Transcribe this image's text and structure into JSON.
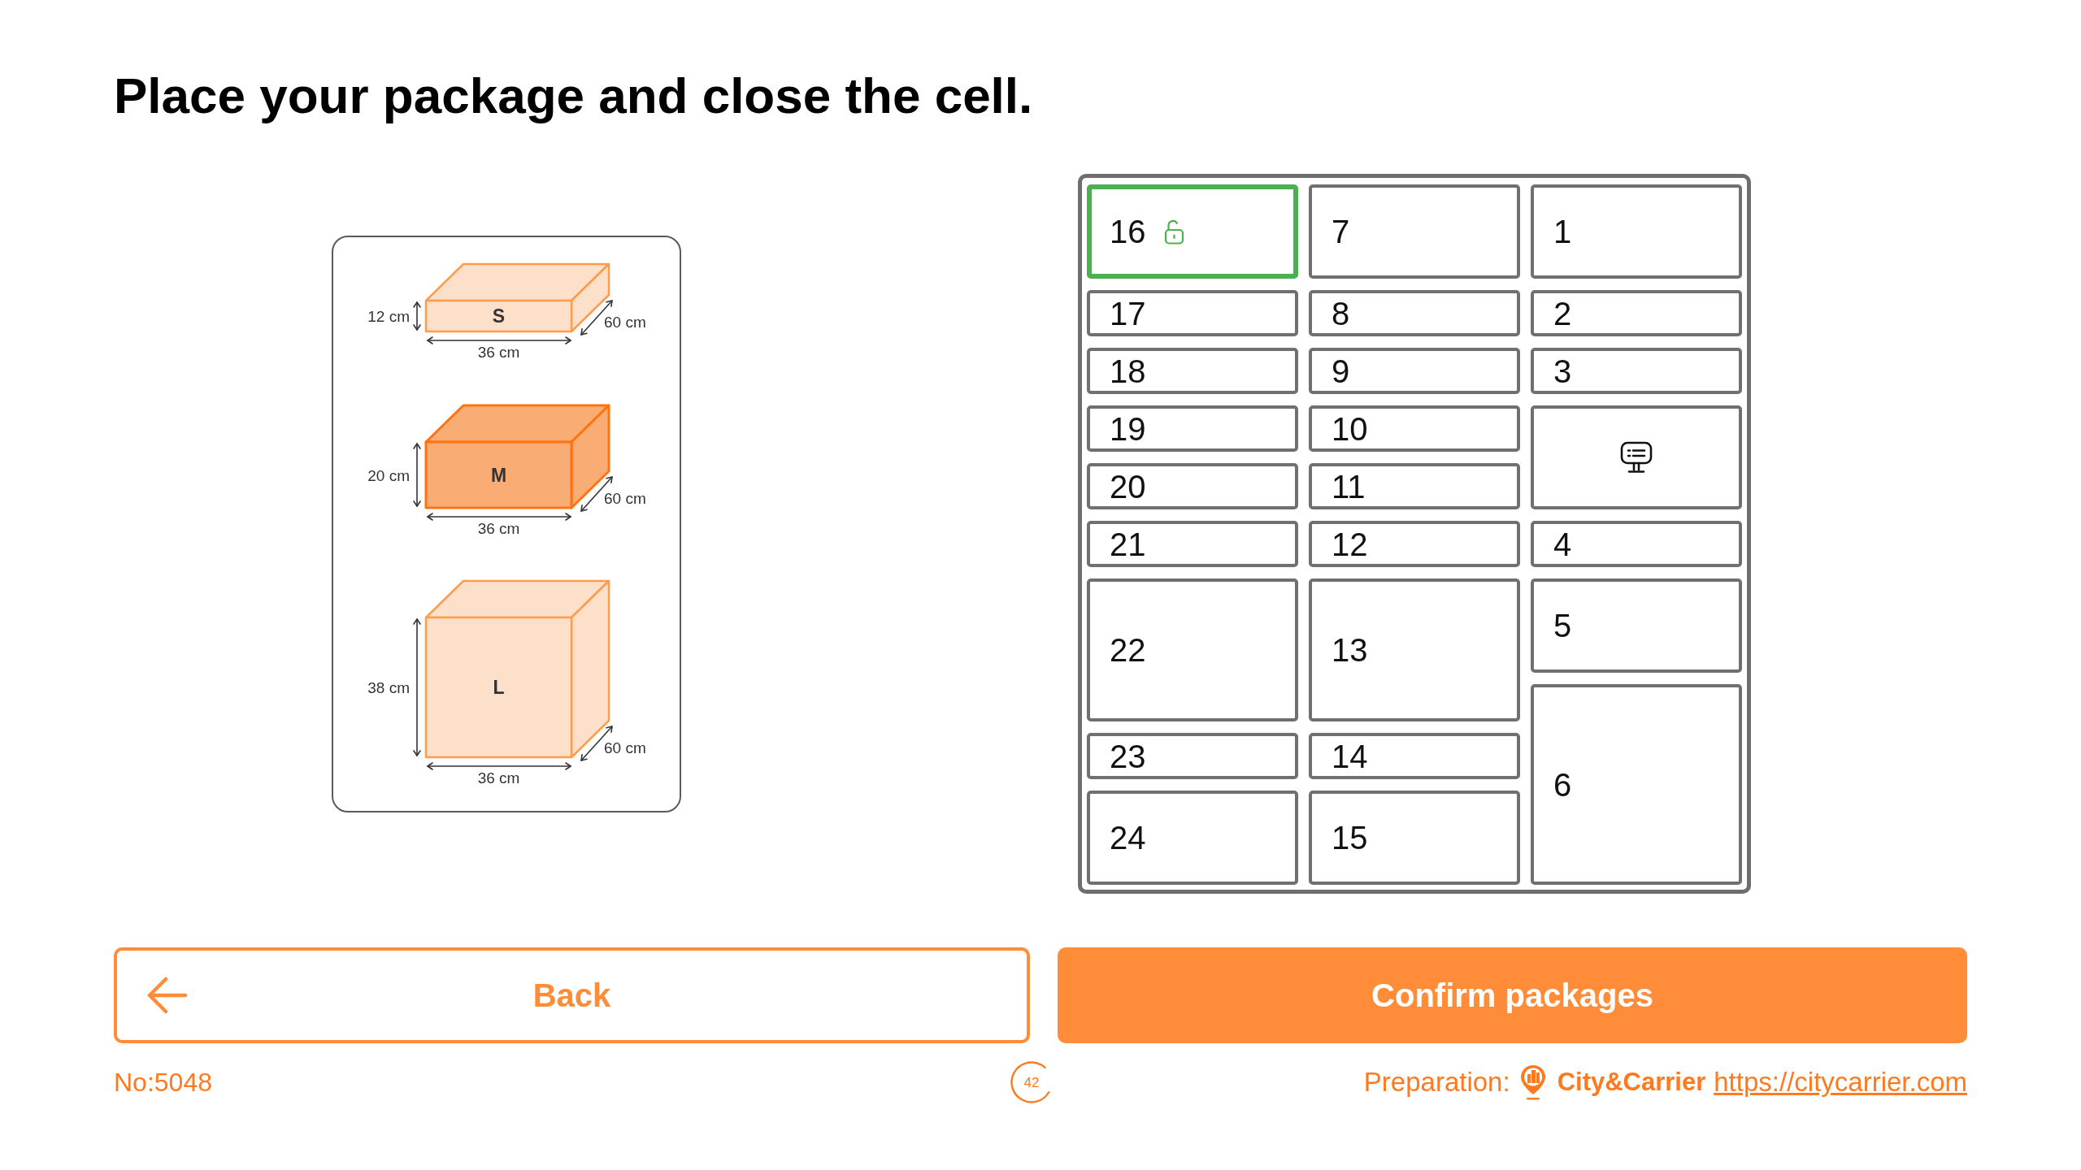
{
  "title": "Place your package and close the cell.",
  "size_guide": {
    "packages": [
      {
        "label": "S",
        "height": "12 cm",
        "width": "36 cm",
        "depth": "60 cm",
        "highlighted": false
      },
      {
        "label": "M",
        "height": "20 cm",
        "width": "36 cm",
        "depth": "60 cm",
        "highlighted": true
      },
      {
        "label": "L",
        "height": "38 cm",
        "width": "36 cm",
        "depth": "60 cm",
        "highlighted": false
      }
    ]
  },
  "locker": {
    "columns": [
      {
        "cells": [
          {
            "kind": "medium",
            "number": "16",
            "selected": true,
            "unlocked": true
          },
          {
            "kind": "small",
            "number": "17",
            "selected": false,
            "unlocked": false
          },
          {
            "kind": "small",
            "number": "18",
            "selected": false,
            "unlocked": false
          },
          {
            "kind": "small",
            "number": "19",
            "selected": false,
            "unlocked": false
          },
          {
            "kind": "small",
            "number": "20",
            "selected": false,
            "unlocked": false
          },
          {
            "kind": "small",
            "number": "21",
            "selected": false,
            "unlocked": false
          },
          {
            "kind": "large",
            "number": "22",
            "selected": false,
            "unlocked": false
          },
          {
            "kind": "small",
            "number": "23",
            "selected": false,
            "unlocked": false
          },
          {
            "kind": "medium",
            "number": "24",
            "selected": false,
            "unlocked": false
          }
        ]
      },
      {
        "cells": [
          {
            "kind": "medium",
            "number": "7",
            "selected": false,
            "unlocked": false
          },
          {
            "kind": "small",
            "number": "8",
            "selected": false,
            "unlocked": false
          },
          {
            "kind": "small",
            "number": "9",
            "selected": false,
            "unlocked": false
          },
          {
            "kind": "small",
            "number": "10",
            "selected": false,
            "unlocked": false
          },
          {
            "kind": "small",
            "number": "11",
            "selected": false,
            "unlocked": false
          },
          {
            "kind": "small",
            "number": "12",
            "selected": false,
            "unlocked": false
          },
          {
            "kind": "large",
            "number": "13",
            "selected": false,
            "unlocked": false
          },
          {
            "kind": "small",
            "number": "14",
            "selected": false,
            "unlocked": false
          },
          {
            "kind": "medium",
            "number": "15",
            "selected": false,
            "unlocked": false
          }
        ]
      },
      {
        "cells": [
          {
            "kind": "medium",
            "number": "1",
            "selected": false,
            "unlocked": false
          },
          {
            "kind": "small",
            "number": "2",
            "selected": false,
            "unlocked": false
          },
          {
            "kind": "small",
            "number": "3",
            "selected": false,
            "unlocked": false
          },
          {
            "kind": "screen",
            "selected": false,
            "unlocked": false
          },
          {
            "kind": "small",
            "number": "4",
            "selected": false,
            "unlocked": false
          },
          {
            "kind": "medium",
            "number": "5",
            "selected": false,
            "unlocked": false
          },
          {
            "kind": "xlarge",
            "number": "6",
            "selected": false,
            "unlocked": false
          }
        ]
      }
    ]
  },
  "buttons": [
    {
      "kind": "back",
      "label": "Back"
    },
    {
      "kind": "confirm",
      "label": "Confirm packages"
    }
  ],
  "footer": {
    "order_number": "No:5048",
    "countdown": "42",
    "preparation_label": "Preparation:",
    "brand": "City&Carrier",
    "link": "https://citycarrier.com"
  }
}
